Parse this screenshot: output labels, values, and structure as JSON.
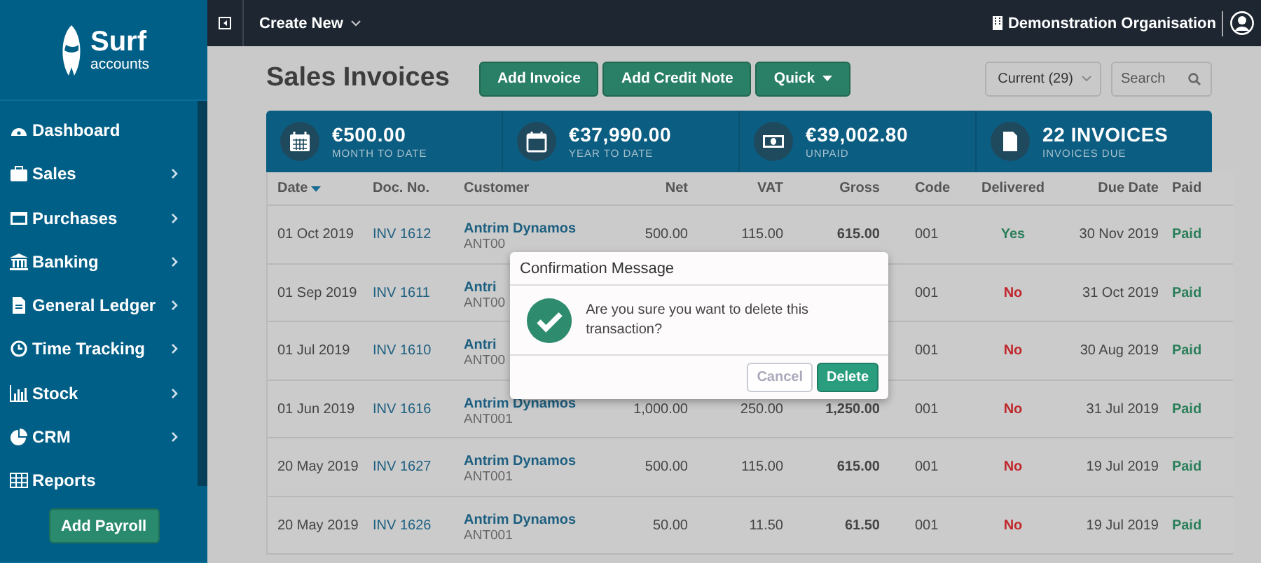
{
  "sidebar": {
    "logo": {
      "name": "Surf",
      "tagline": "accounts"
    },
    "items": [
      {
        "label": "Dashboard",
        "has_submenu": false
      },
      {
        "label": "Sales",
        "has_submenu": true
      },
      {
        "label": "Purchases",
        "has_submenu": true
      },
      {
        "label": "Banking",
        "has_submenu": true
      },
      {
        "label": "General Ledger",
        "has_submenu": true
      },
      {
        "label": "Time Tracking",
        "has_submenu": true
      },
      {
        "label": "Stock",
        "has_submenu": true
      },
      {
        "label": "CRM",
        "has_submenu": true
      },
      {
        "label": "Reports",
        "has_submenu": false
      }
    ],
    "button": "Add Payroll"
  },
  "topbar": {
    "create_new": "Create New",
    "organisation": "Demonstration Organisation"
  },
  "page": {
    "title": "Sales Invoices",
    "buttons": [
      "Add Invoice",
      "Add Credit Note",
      "Quick"
    ],
    "filter": "Current (29)",
    "search": {
      "placeholder": "Search"
    }
  },
  "stats": [
    {
      "value": "€500.00",
      "label": "MONTH TO DATE"
    },
    {
      "value": "€37,990.00",
      "label": "YEAR TO DATE"
    },
    {
      "value": "€39,002.80",
      "label": "UNPAID"
    },
    {
      "value": "22 INVOICES",
      "label": "INVOICES DUE"
    }
  ],
  "table": {
    "columns": [
      "Date",
      "Doc. No.",
      "Customer",
      "Net",
      "VAT",
      "Gross",
      "Code",
      "Delivered",
      "Due Date",
      "Paid"
    ],
    "rows": [
      {
        "date": "01 Oct 2019",
        "doc": "INV 1612",
        "customer": "Antrim Dynamos",
        "customer_code": "ANT00",
        "net": "500.00",
        "vat": "115.00",
        "gross": "615.00",
        "code": "001",
        "delivered": "Yes",
        "due": "30 Nov 2019",
        "paid": "Paid"
      },
      {
        "date": "01 Sep 2019",
        "doc": "INV 1611",
        "customer": "Antri",
        "customer_code": "ANT00",
        "code": "001",
        "delivered": "No",
        "due": "31 Oct 2019",
        "paid": "Paid"
      },
      {
        "date": "01 Jul 2019",
        "doc": "INV 1610",
        "customer": "Antri",
        "customer_code": "ANT00",
        "code": "001",
        "delivered": "No",
        "due": "30 Aug 2019",
        "paid": "Paid"
      },
      {
        "date": "01 Jun 2019",
        "doc": "INV 1616",
        "customer": "Antrim Dynamos",
        "customer_code": "ANT001",
        "net": "1,000.00",
        "vat": "250.00",
        "gross": "1,250.00",
        "code": "001",
        "delivered": "No",
        "due": "31 Jul 2019",
        "paid": "Paid"
      },
      {
        "date": "20 May 2019",
        "doc": "INV 1627",
        "customer": "Antrim Dynamos",
        "customer_code": "ANT001",
        "net": "500.00",
        "vat": "115.00",
        "gross": "615.00",
        "code": "001",
        "delivered": "No",
        "due": "19 Jul 2019",
        "paid": "Paid"
      },
      {
        "date": "20 May 2019",
        "doc": "INV 1626",
        "customer": "Antrim Dynamos",
        "customer_code": "ANT001",
        "net": "50.00",
        "vat": "11.50",
        "gross": "61.50",
        "code": "001",
        "delivered": "No",
        "due": "19 Jul 2019",
        "paid": "Paid"
      }
    ]
  },
  "dialog": {
    "title": "Confirmation Message",
    "message": "Are you sure you want to delete this transaction?",
    "cancel": {
      "label": "Cancel",
      "disabled": true
    },
    "confirm": "Delete"
  }
}
